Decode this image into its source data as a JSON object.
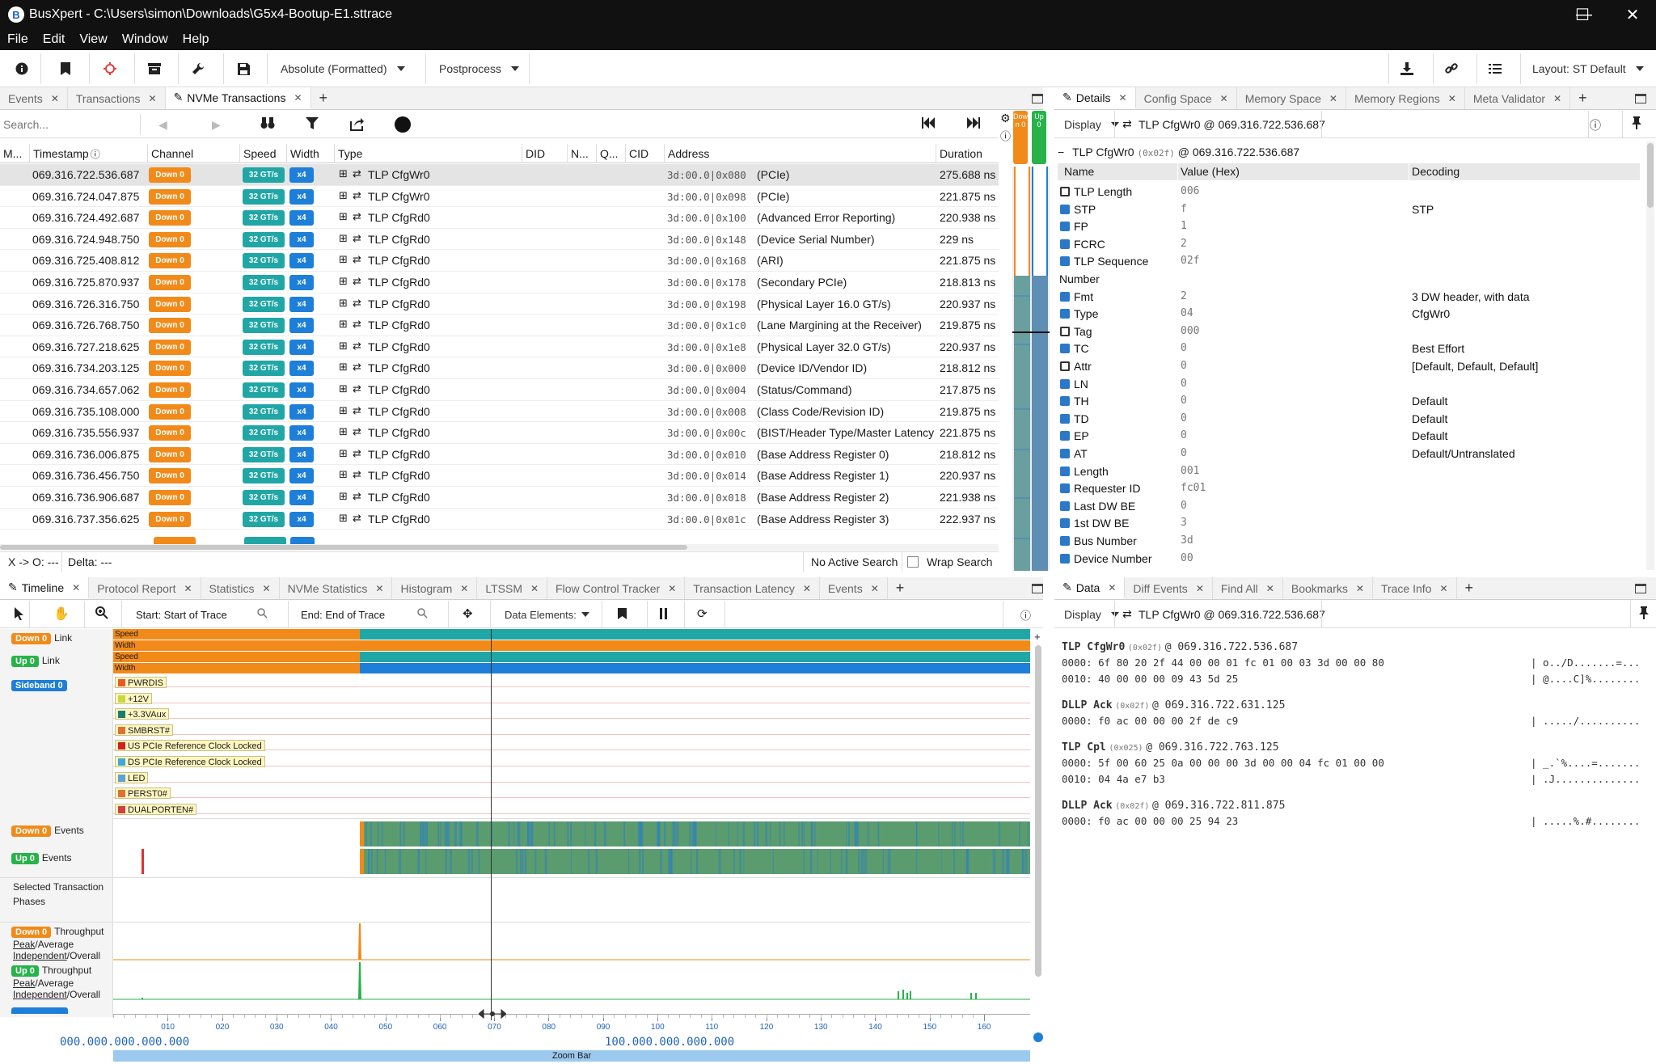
{
  "window": {
    "app_name": "BusXpert",
    "title": "BusXpert - C:\\Users\\simon\\Downloads\\G5x4-Bootup-E1.sttrace",
    "minimize": "—",
    "maximize": "☐",
    "close": "✕"
  },
  "menu": [
    "File",
    "Edit",
    "View",
    "Window",
    "Help"
  ],
  "toolbar": {
    "time_format": "Absolute (Formatted)",
    "postprocess": "Postprocess",
    "layout": "Layout: ST Default"
  },
  "left_tabs": [
    {
      "label": "Events"
    },
    {
      "label": "Transactions"
    },
    {
      "label": "NVMe Transactions"
    }
  ],
  "search": {
    "placeholder": "Search..."
  },
  "columns": [
    "M...",
    "Timestamp",
    "Channel",
    "Speed",
    "Width",
    "Type",
    "DID",
    "N...",
    "Q...",
    "CID",
    "Address",
    "Duration"
  ],
  "transactions": [
    {
      "ts": "069.316.722.536.687",
      "ch": "Down 0",
      "speed": "32 GT/s",
      "width": "x4",
      "type": "TLP CfgWr0",
      "addr": "3d:00.0|0x080",
      "desc": "(PCIe)",
      "dur": "275.688 ns"
    },
    {
      "ts": "069.316.724.047.875",
      "ch": "Down 0",
      "speed": "32 GT/s",
      "width": "x4",
      "type": "TLP CfgWr0",
      "addr": "3d:00.0|0x098",
      "desc": "(PCIe)",
      "dur": "221.875 ns"
    },
    {
      "ts": "069.316.724.492.687",
      "ch": "Down 0",
      "speed": "32 GT/s",
      "width": "x4",
      "type": "TLP CfgRd0",
      "addr": "3d:00.0|0x100",
      "desc": "(Advanced Error Reporting)",
      "dur": "220.938 ns"
    },
    {
      "ts": "069.316.724.948.750",
      "ch": "Down 0",
      "speed": "32 GT/s",
      "width": "x4",
      "type": "TLP CfgRd0",
      "addr": "3d:00.0|0x148",
      "desc": "(Device Serial Number)",
      "dur": "229 ns"
    },
    {
      "ts": "069.316.725.408.812",
      "ch": "Down 0",
      "speed": "32 GT/s",
      "width": "x4",
      "type": "TLP CfgRd0",
      "addr": "3d:00.0|0x168",
      "desc": "(ARI)",
      "dur": "221.875 ns"
    },
    {
      "ts": "069.316.725.870.937",
      "ch": "Down 0",
      "speed": "32 GT/s",
      "width": "x4",
      "type": "TLP CfgRd0",
      "addr": "3d:00.0|0x178",
      "desc": "(Secondary PCIe)",
      "dur": "218.813 ns"
    },
    {
      "ts": "069.316.726.316.750",
      "ch": "Down 0",
      "speed": "32 GT/s",
      "width": "x4",
      "type": "TLP CfgRd0",
      "addr": "3d:00.0|0x198",
      "desc": "(Physical Layer 16.0 GT/s)",
      "dur": "220.937 ns"
    },
    {
      "ts": "069.316.726.768.750",
      "ch": "Down 0",
      "speed": "32 GT/s",
      "width": "x4",
      "type": "TLP CfgRd0",
      "addr": "3d:00.0|0x1c0",
      "desc": "(Lane Margining at the Receiver)",
      "dur": "219.875 ns"
    },
    {
      "ts": "069.316.727.218.625",
      "ch": "Down 0",
      "speed": "32 GT/s",
      "width": "x4",
      "type": "TLP CfgRd0",
      "addr": "3d:00.0|0x1e8",
      "desc": "(Physical Layer 32.0 GT/s)",
      "dur": "220.937 ns"
    },
    {
      "ts": "069.316.734.203.125",
      "ch": "Down 0",
      "speed": "32 GT/s",
      "width": "x4",
      "type": "TLP CfgRd0",
      "addr": "3d:00.0|0x000",
      "desc": "(Device ID/Vendor ID)",
      "dur": "218.812 ns"
    },
    {
      "ts": "069.316.734.657.062",
      "ch": "Down 0",
      "speed": "32 GT/s",
      "width": "x4",
      "type": "TLP CfgRd0",
      "addr": "3d:00.0|0x004",
      "desc": "(Status/Command)",
      "dur": "217.875 ns"
    },
    {
      "ts": "069.316.735.108.000",
      "ch": "Down 0",
      "speed": "32 GT/s",
      "width": "x4",
      "type": "TLP CfgRd0",
      "addr": "3d:00.0|0x008",
      "desc": "(Class Code/Revision ID)",
      "dur": "219.875 ns"
    },
    {
      "ts": "069.316.735.556.937",
      "ch": "Down 0",
      "speed": "32 GT/s",
      "width": "x4",
      "type": "TLP CfgRd0",
      "addr": "3d:00.0|0x00c",
      "desc": "(BIST/Header Type/Master Latency",
      "dur": "221.875 ns"
    },
    {
      "ts": "069.316.736.006.875",
      "ch": "Down 0",
      "speed": "32 GT/s",
      "width": "x4",
      "type": "TLP CfgRd0",
      "addr": "3d:00.0|0x010",
      "desc": "(Base Address Register 0)",
      "dur": "218.812 ns"
    },
    {
      "ts": "069.316.736.456.750",
      "ch": "Down 0",
      "speed": "32 GT/s",
      "width": "x4",
      "type": "TLP CfgRd0",
      "addr": "3d:00.0|0x014",
      "desc": "(Base Address Register 1)",
      "dur": "220.937 ns"
    },
    {
      "ts": "069.316.736.906.687",
      "ch": "Down 0",
      "speed": "32 GT/s",
      "width": "x4",
      "type": "TLP CfgRd0",
      "addr": "3d:00.0|0x018",
      "desc": "(Base Address Register 2)",
      "dur": "221.938 ns"
    },
    {
      "ts": "069.316.737.356.625",
      "ch": "Down 0",
      "speed": "32 GT/s",
      "width": "x4",
      "type": "TLP CfgRd0",
      "addr": "3d:00.0|0x01c",
      "desc": "(Base Address Register 3)",
      "dur": "222.937 ns"
    }
  ],
  "status_bar": {
    "cursor": "X -> O: ---",
    "delta": "Delta: ---",
    "search_status": "No Active Search",
    "wrap": "Wrap Search"
  },
  "side_channels": {
    "down": "Down 0",
    "up": "Up 0"
  },
  "right_tabs": [
    {
      "label": "Details"
    },
    {
      "label": "Config Space"
    },
    {
      "label": "Memory Space"
    },
    {
      "label": "Memory Regions"
    },
    {
      "label": "Meta Validator"
    }
  ],
  "details": {
    "display": "Display",
    "header": "TLP CfgWr0 @ 069.316.722.536.687",
    "root_label": "TLP CfgWr0",
    "root_id": "(0x02f)",
    "root_ts": "@ 069.316.722.536.687",
    "cols": [
      "Name",
      "Value (Hex)",
      "Decoding"
    ],
    "fields": [
      {
        "name": "TLP Length",
        "value": "006",
        "decoding": ""
      },
      {
        "name": "STP",
        "value": "f",
        "decoding": "STP"
      },
      {
        "name": "FP",
        "value": "1",
        "decoding": ""
      },
      {
        "name": "FCRC",
        "value": "2",
        "decoding": ""
      },
      {
        "name": "TLP Sequence",
        "value": "02f",
        "decoding": ""
      },
      {
        "name": "Number",
        "value": "",
        "decoding": ""
      },
      {
        "name": "Fmt",
        "value": "2",
        "decoding": "3 DW header, with data"
      },
      {
        "name": "Type",
        "value": "04",
        "decoding": "CfgWr0"
      },
      {
        "name": "Tag",
        "value": "000",
        "decoding": ""
      },
      {
        "name": "TC",
        "value": "0",
        "decoding": "Best Effort"
      },
      {
        "name": "Attr",
        "value": "0",
        "decoding": "[Default, Default, Default]"
      },
      {
        "name": "LN",
        "value": "0",
        "decoding": ""
      },
      {
        "name": "TH",
        "value": "0",
        "decoding": "Default"
      },
      {
        "name": "TD",
        "value": "0",
        "decoding": "Default"
      },
      {
        "name": "EP",
        "value": "0",
        "decoding": "Default"
      },
      {
        "name": "AT",
        "value": "0",
        "decoding": "Default/Untranslated"
      },
      {
        "name": "Length",
        "value": "001",
        "decoding": ""
      },
      {
        "name": "Requester ID",
        "value": "fc01",
        "decoding": ""
      },
      {
        "name": "Last DW BE",
        "value": "0",
        "decoding": ""
      },
      {
        "name": "1st DW BE",
        "value": "3",
        "decoding": ""
      },
      {
        "name": "Bus Number",
        "value": "3d",
        "decoding": ""
      },
      {
        "name": "Device Number",
        "value": "00",
        "decoding": ""
      }
    ]
  },
  "bottom_tabs": [
    {
      "label": "Timeline"
    },
    {
      "label": "Protocol Report"
    },
    {
      "label": "Statistics"
    },
    {
      "label": "NVMe Statistics"
    },
    {
      "label": "Histogram"
    },
    {
      "label": "LTSSM"
    },
    {
      "label": "Flow Control Tracker"
    },
    {
      "label": "Transaction Latency"
    },
    {
      "label": "Events"
    }
  ],
  "timeline": {
    "start": "Start: Start of Trace",
    "end": "End: End of Trace",
    "data_elements": "Data Elements:",
    "link_down": "Down 0",
    "link_up": "Up 0",
    "link_word": "Link",
    "bar_labels": [
      "Speed",
      "Width",
      "Speed",
      "Width"
    ],
    "sideband": "Sideband 0",
    "signals": [
      "PWRDIS",
      "+12V",
      "+3.3VAux",
      "SMBRST#",
      "US PCIe Reference Clock Locked",
      "DS PCIe Reference Clock Locked",
      "LED",
      "PERST0#",
      "DUALPORTEN#"
    ],
    "events_word": "Events",
    "selected1": "Selected Transaction",
    "selected2": "Phases",
    "throughput": "Throughput",
    "peak": "Peak",
    "average": "/Average",
    "independent": "Independent",
    "overall": "/Overall",
    "ticks": [
      "010",
      "020",
      "030",
      "040",
      "050",
      "060",
      "070",
      "080",
      "090",
      "100",
      "110",
      "120",
      "130",
      "140",
      "150",
      "160"
    ],
    "range_start": "000.000.000.000.000",
    "range_end": "100.000.000.000.000",
    "zoom_bar": "Zoom Bar"
  },
  "data_tabs": [
    {
      "label": "Data"
    },
    {
      "label": "Diff Events"
    },
    {
      "label": "Find All"
    },
    {
      "label": "Bookmarks"
    },
    {
      "label": "Trace Info"
    }
  ],
  "data_panel": {
    "display": "Display",
    "header": "TLP CfgWr0 @ 069.316.722.536.687",
    "packets": [
      {
        "title": "TLP CfgWr0",
        "id": "(0x02f)",
        "ts": "@ 069.316.722.536.687",
        "lines": [
          [
            "0000: 6f 80 20 2f 44 00 00 01 fc 01 00 03 3d 00 00 80",
            "| o../D.......=..."
          ],
          [
            "0010: 40 00 00 00 09 43 5d 25",
            "| @....C]%........"
          ]
        ]
      },
      {
        "title": "DLLP Ack",
        "id": "(0x02f)",
        "ts": "@ 069.316.722.631.125",
        "lines": [
          [
            "0000: f0 ac 00 00 00 2f de c9",
            "| ...../.........."
          ]
        ]
      },
      {
        "title": "TLP Cpl",
        "id": "(0x025)",
        "ts": "@ 069.316.722.763.125",
        "lines": [
          [
            "0000: 5f 00 60 25 0a 00 00 00 3d 00 00 04 fc 01 00 00",
            "| _.`%....=......."
          ],
          [
            "0010: 04 4a e7 b3",
            "| .J.............."
          ]
        ]
      },
      {
        "title": "DLLP Ack",
        "id": "(0x02f)",
        "ts": "@ 069.316.722.811.875",
        "lines": [
          [
            "0000: f0 ac 00 00 00 25 94 23",
            "| .....%.#........"
          ]
        ]
      }
    ]
  },
  "colors": {
    "orange": "#f28a1a",
    "teal": "#21a6a6",
    "blue": "#1e7fd8",
    "green": "#27b34a",
    "event_green": "#5b9c6e"
  }
}
